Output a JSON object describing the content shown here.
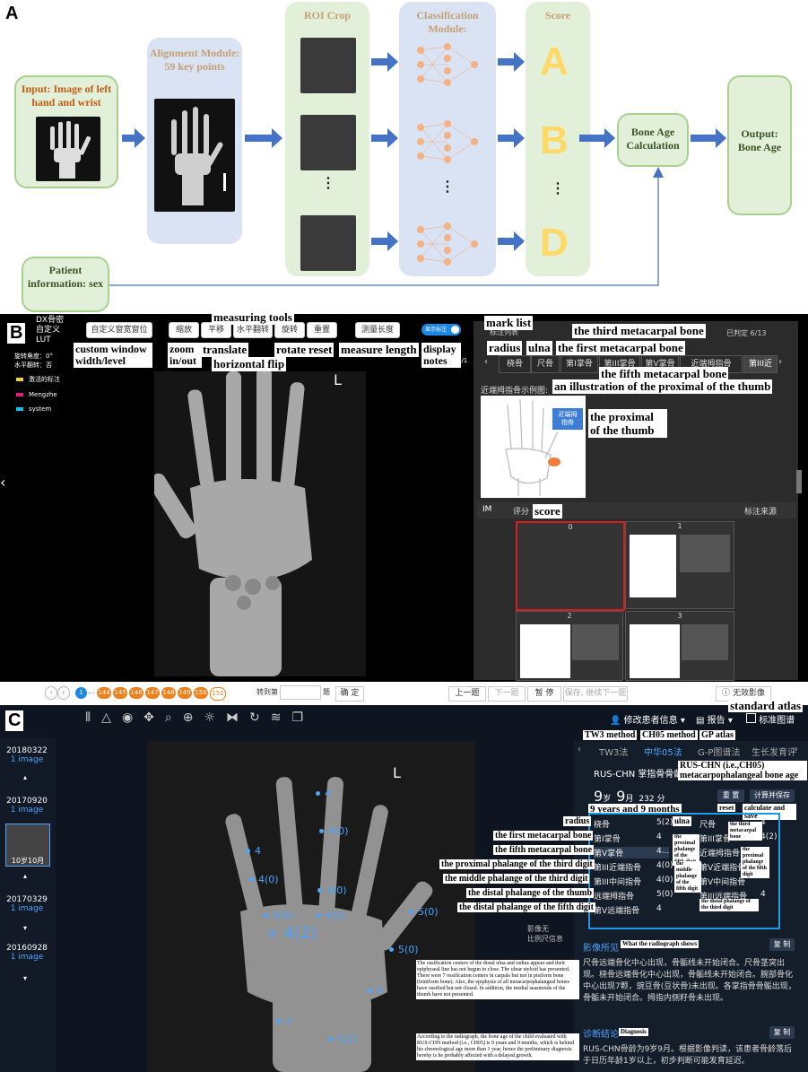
{
  "panel_labels": {
    "a": "A",
    "b": "B",
    "c": "C"
  },
  "section_a": {
    "input_label": "Input: Image of left hand and wrist",
    "alignment_label": "Alignment Module: 59 key points",
    "roi_label": "ROI Crop",
    "classification_label": "Classification Module:",
    "score_label": "Score",
    "score_letters": [
      "A",
      "B",
      "D"
    ],
    "bone_age_calc": "Bone Age Calculation",
    "output_label": "Output: Bone Age",
    "patient_label": "Patient information: sex",
    "vertical_dots": "⋮"
  },
  "section_b": {
    "sidebar_title": "DX骨密\n自定义\nLUT",
    "rotate_angle": "旋转角度：0°",
    "h_flip": "水平翻转：否",
    "legend": [
      {
        "label": "激活的标注",
        "color": "#f0d040"
      },
      {
        "label": "Mengzhe",
        "color": "#e0207a"
      },
      {
        "label": "system",
        "color": "#29b6e8"
      }
    ],
    "toolbar": {
      "custom_window": "自定义窗宽窗位",
      "zoom": "缩放",
      "translate": "平移",
      "hflip": "水平翻转",
      "rotate": "旋转",
      "reset": "重置",
      "measure": "测量长度",
      "display_notes": "显示标注"
    },
    "annotations": {
      "measuring_tools": "measuring tools",
      "custom_window": "custom window width/level",
      "zoom": "zoom in/out",
      "translate": "translate",
      "hflip": "horizontal flip",
      "rotate": "rotate",
      "reset": "reset",
      "measure": "measure length",
      "display_notes": "display notes",
      "mark_list": "mark list",
      "third_metacarpal": "the third metacarpal bone",
      "radius": "radius",
      "ulna": "ulna",
      "first_metacarpal": "the first metacarpal bone",
      "fifth_metacarpal": "the fifth metacarpal bone",
      "illustration": "an illustration of the proximal of the thumb",
      "proximal_thumb": "the proximal of the thumb",
      "score": "score"
    },
    "page_indicator": "1/1",
    "xray_marker": "L",
    "mark_list_header": "标注列表",
    "judged": "已判定 6/13",
    "tabs": [
      "桡骨",
      "尺骨",
      "第I掌骨",
      "第III掌骨",
      "第V掌骨",
      "近端拇指骨",
      "第III近"
    ],
    "example_label": "近端拇指骨示例图:",
    "example_tag": "近端拇\n指骨",
    "score_bar": {
      "im": "IM",
      "pingfen": "评分",
      "biaozhu": "标注来源"
    },
    "score_cards": [
      "0",
      "1",
      "2",
      "3"
    ],
    "pagination": {
      "first": "1",
      "ellipsis": "...",
      "pages": [
        "144",
        "145",
        "146",
        "147",
        "148",
        "149",
        "150",
        "151"
      ],
      "goto": "转到第",
      "ti": "题",
      "confirm": "确 定"
    },
    "bottom_buttons": {
      "prev": "上一题",
      "next": "下一题",
      "pause": "暂 停",
      "save_next": "保存, 继续下一题",
      "invalid": "无效影像"
    }
  },
  "section_c": {
    "toolbar_right": {
      "edit_patient": "修改患者信息",
      "report": "报告",
      "standard_atlas": "标准图谱"
    },
    "annotations": {
      "standard_atlas": "standard atlas",
      "tw3": "TW3 method",
      "ch05": "CH05 method",
      "gp": "GP atlas",
      "rus": "RUS-CHN (i.e.,CH05) metacarpophalangeal bone age",
      "age_en": "9 years and 9 months",
      "reset": "reset",
      "calc_save": "calculate and save",
      "radius": "radius",
      "ulna": "ulna",
      "first_meta": "the first metacarpal bone",
      "fifth_meta": "the fifth metacarpal bone",
      "prox3": "the proximal phalange of the third digit",
      "mid3": "the middle phalange of the third digit",
      "dist_thumb": "the distal phalange of the thumb",
      "dist5": "the distal phalange of the fifth digit",
      "third_meta_r": "the third metacarpal bone",
      "prox5_r": "the proximal phalange of the fifth digit",
      "mid5_r": "the middle phalange of the fifth digit",
      "prox_thumb_r": "the proximal phalange of the fifth digit",
      "dist3_r": "the distal phalange of the third digit",
      "radiograph_shows": "What the radiograph shows",
      "diagnosis": "Diagnosis",
      "findings_en": "The ossification centers of the distal ulna and radius appear and their epiphyseal line has not begun to close. The ulnar styloid has presented. There were 7 ossification centers in carpals but not in pisiform bone (lentiform bone). Also, the epiphysis of all metacarpophalangeal bones have ossified but not closed. In addition, the medial seasmoids of the thumb have not presented.",
      "diagnosis_en": "According to the radiograph, the bone age of the child evaluated with RUS-CHN method (i.e., CH05) is 9 years and 9 months, which is behind his chronological age more than 1 year, hence the preliminary diagnosis hereby is he probably affected with a delayed growth."
    },
    "dates": [
      {
        "date": "20180322",
        "sub": "1 image"
      },
      {
        "date": "20170920",
        "sub": "1 image"
      },
      {
        "date": "20170329",
        "sub": "1 image"
      },
      {
        "date": "20160928",
        "sub": "1 image"
      }
    ],
    "thumb_caption": "10岁10月",
    "tabs": [
      "TW3法",
      "中华05法",
      "G-P图谱法",
      "生长发育评"
    ],
    "rus_title": "RUS-CHN 掌指骨骨龄",
    "age": {
      "years": "9",
      "years_unit": "岁",
      "months": "9",
      "months_unit": "月",
      "days": "232 分"
    },
    "buttons": {
      "reset": "重 置",
      "calc_save": "计算并保存",
      "copy1": "复 制",
      "copy2": "复 制"
    },
    "table_left": [
      {
        "name": "桡骨",
        "score": "5(2)"
      },
      {
        "name": "第I掌骨",
        "score": "4"
      },
      {
        "name": "第V掌骨",
        "score": "4..."
      },
      {
        "name": "第III近端指骨",
        "score": "4(0)"
      },
      {
        "name": "第III中间指骨",
        "score": "4(0)"
      },
      {
        "name": "远端拇指骨",
        "score": "5(0)"
      },
      {
        "name": "第V远端指骨",
        "score": "4"
      }
    ],
    "table_right": [
      {
        "name": "尺骨",
        "score": "4"
      },
      {
        "name": "第III掌骨",
        "score": "4(2)"
      },
      {
        "name": "近端拇指骨",
        "score": ""
      },
      {
        "name": "第V近端指骨",
        "score": ""
      },
      {
        "name": "第V中间指骨",
        "score": ""
      },
      {
        "name": "第III远端指骨",
        "score": "4"
      }
    ],
    "image_info": "影像无\n比例尺信息",
    "findings_title": "影像所见",
    "findings_text": "尺骨远端骨化中心出现，骨骺线未开始闭合。尺骨茎突出现。桡骨远端骨化中心出现，骨骺线未开始闭合。腕部骨化中心出现7颗，豌豆骨(豆状骨)未出现。各掌指骨骨骺出现，骨骺未开始闭合。拇指内侧籽骨未出现。",
    "diag_title": "诊断结论",
    "diag_text": "RUS-CHN骨龄为9岁9月。根据影像判读，该患者骨龄落后于日历年龄1岁以上，初步判断可能发育延迟。",
    "xray_marker": "L",
    "xray_labels": [
      "4",
      "4(0)",
      "4",
      "4(0)",
      "4(0)",
      "4(0)",
      "4(2)",
      "5(0)",
      "4(2)",
      "5(0)",
      "4",
      "4",
      "5(2)"
    ]
  }
}
